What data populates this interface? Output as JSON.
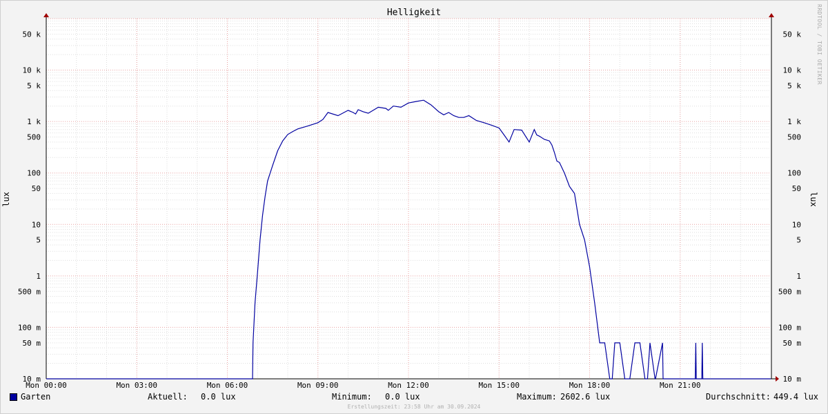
{
  "chart_data": {
    "type": "line",
    "title": "Helligkeit",
    "ylabel": "lux",
    "yscale": "log",
    "ylim": [
      0.01,
      100000
    ],
    "xlim": [
      "Mon 00:00",
      "Tue 00:00"
    ],
    "x_ticks": [
      "Mon 00:00",
      "Mon 03:00",
      "Mon 06:00",
      "Mon 09:00",
      "Mon 12:00",
      "Mon 15:00",
      "Mon 18:00",
      "Mon 21:00"
    ],
    "y_ticks": [
      {
        "value": 0.01,
        "label": "10 m"
      },
      {
        "value": 0.05,
        "label": "50 m"
      },
      {
        "value": 0.1,
        "label": "100 m"
      },
      {
        "value": 0.5,
        "label": "500 m"
      },
      {
        "value": 1,
        "label": "1"
      },
      {
        "value": 5,
        "label": "5"
      },
      {
        "value": 10,
        "label": "10"
      },
      {
        "value": 50,
        "label": "50"
      },
      {
        "value": 100,
        "label": "100"
      },
      {
        "value": 500,
        "label": "500"
      },
      {
        "value": 1000,
        "label": "1 k"
      },
      {
        "value": 5000,
        "label": "5 k"
      },
      {
        "value": 10000,
        "label": "10 k"
      },
      {
        "value": 50000,
        "label": "50 k"
      }
    ],
    "grid": true,
    "series": [
      {
        "name": "Garten",
        "color": "#0000a0",
        "x": [
          "Mon 00:00",
          "Mon 06:50",
          "Mon 06:51",
          "Mon 06:55",
          "Mon 07:00",
          "Mon 07:05",
          "Mon 07:10",
          "Mon 07:15",
          "Mon 07:20",
          "Mon 07:30",
          "Mon 07:40",
          "Mon 07:50",
          "Mon 08:00",
          "Mon 08:10",
          "Mon 08:20",
          "Mon 08:40",
          "Mon 09:00",
          "Mon 09:10",
          "Mon 09:20",
          "Mon 09:40",
          "Mon 10:00",
          "Mon 10:10",
          "Mon 10:15",
          "Mon 10:20",
          "Mon 10:30",
          "Mon 10:40",
          "Mon 11:00",
          "Mon 11:15",
          "Mon 11:20",
          "Mon 11:30",
          "Mon 11:45",
          "Mon 12:00",
          "Mon 12:15",
          "Mon 12:30",
          "Mon 12:45",
          "Mon 13:00",
          "Mon 13:10",
          "Mon 13:20",
          "Mon 13:30",
          "Mon 13:40",
          "Mon 13:50",
          "Mon 14:00",
          "Mon 14:15",
          "Mon 14:30",
          "Mon 14:45",
          "Mon 15:00",
          "Mon 15:10",
          "Mon 15:20",
          "Mon 15:30",
          "Mon 15:45",
          "Mon 16:00",
          "Mon 16:10",
          "Mon 16:15",
          "Mon 16:20",
          "Mon 16:30",
          "Mon 16:40",
          "Mon 16:45",
          "Mon 16:50",
          "Mon 16:55",
          "Mon 17:00",
          "Mon 17:10",
          "Mon 17:20",
          "Mon 17:30",
          "Mon 17:40",
          "Mon 17:50",
          "Mon 18:00",
          "Mon 18:10",
          "Mon 18:20",
          "Mon 18:30",
          "Mon 18:40",
          "Mon 18:45",
          "Mon 18:50",
          "Mon 19:00",
          "Mon 19:10",
          "Mon 19:20",
          "Mon 19:30",
          "Mon 19:40",
          "Mon 19:50",
          "Mon 19:55",
          "Mon 20:00",
          "Mon 20:10",
          "Mon 20:11",
          "Mon 20:25",
          "Mon 20:26",
          "Mon 21:30",
          "Mon 21:31",
          "Mon 21:32",
          "Mon 21:43",
          "Mon 21:44",
          "Mon 21:45",
          "Mon 21:51",
          "Mon 21:52",
          "Mon 21:53",
          "Tue 00:00"
        ],
        "values": [
          0.01,
          0.01,
          0.05,
          0.3,
          1.2,
          5,
          15,
          35,
          70,
          140,
          270,
          420,
          560,
          640,
          720,
          820,
          950,
          1100,
          1500,
          1300,
          1650,
          1500,
          1400,
          1700,
          1550,
          1450,
          1900,
          1800,
          1650,
          2000,
          1900,
          2300,
          2450,
          2600,
          2100,
          1550,
          1350,
          1500,
          1300,
          1200,
          1200,
          1300,
          1050,
          950,
          850,
          750,
          550,
          400,
          700,
          680,
          400,
          700,
          550,
          520,
          450,
          420,
          350,
          250,
          170,
          160,
          100,
          55,
          40,
          10,
          5,
          1.5,
          0.3,
          0.05,
          0.05,
          0.01,
          0.01,
          0.05,
          0.05,
          0.01,
          0.01,
          0.05,
          0.05,
          0.01,
          0.01,
          0.05,
          0.01,
          0.01,
          0.05,
          0.01,
          0.01,
          0.05,
          0.01,
          0.01,
          0.05,
          0.01,
          0.01,
          0.01,
          0.01,
          0.01
        ]
      }
    ]
  },
  "watermark": "RRDTOOL / TOBI OETIKER",
  "legend": {
    "series_name": "Garten",
    "current_label": "Aktuell:",
    "current_value": "0.0 lux",
    "min_label": "Minimum:",
    "min_value": "0.0 lux",
    "max_label": "Maximum:",
    "max_value": "2602.6 lux",
    "avg_label": "Durchschnitt:",
    "avg_value": "449.4 lux"
  },
  "footer": "Erstellungszeit: 23:58 Uhr am 30.09.2024"
}
